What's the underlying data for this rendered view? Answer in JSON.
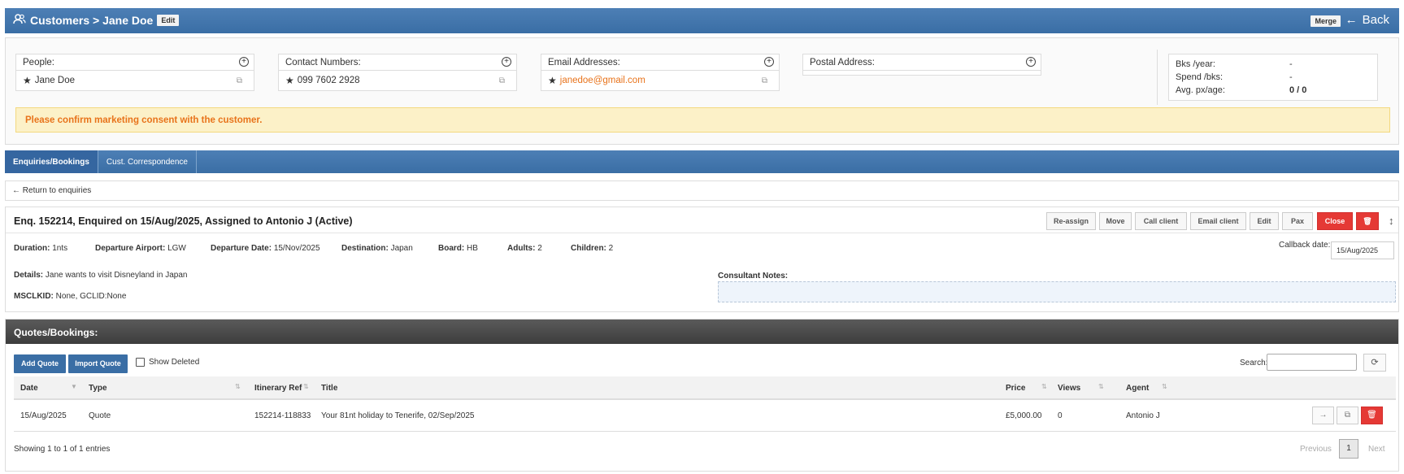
{
  "header": {
    "title": "Customers > Jane Doe",
    "edit_label": "Edit",
    "merge_label": "Merge",
    "back_label": "Back",
    "icon": "users-icon"
  },
  "customer": {
    "people_label": "People:",
    "people_value": "Jane Doe",
    "contact_label": "Contact Numbers:",
    "contact_value": "099 7602 2928",
    "email_label": "Email Addresses:",
    "email_value": "janedoe@gmail.com",
    "postal_label": "Postal Address:",
    "postal_value": "",
    "stats": [
      {
        "label": "Bks /year:",
        "value": "-"
      },
      {
        "label": "Spend /bks:",
        "value": "-"
      },
      {
        "label": "Avg. px/age:",
        "value": "0 / 0"
      }
    ],
    "alert": "Please confirm marketing consent with the customer."
  },
  "tabs": [
    "Enquiries/Bookings",
    "Cust. Correspondence"
  ],
  "return_label": "Return to enquiries",
  "enquiry": {
    "title": "Enq. 152214, Enquired on 15/Aug/2025, Assigned to Antonio J (Active)",
    "actions": [
      "Re-assign",
      "Move",
      "Call client",
      "Email client",
      "Edit",
      "Pax",
      "Close"
    ],
    "duration_label": "Duration:",
    "duration": "1nts",
    "airport_label": "Departure Airport:",
    "airport": "LGW",
    "depdate_label": "Departure Date:",
    "depdate": "15/Nov/2025",
    "dest_label": "Destination:",
    "dest": "Japan",
    "board_label": "Board:",
    "board": "HB",
    "adults_label": "Adults:",
    "adults": "2",
    "children_label": "Children:",
    "children": "2",
    "callback_label": "Callback date:",
    "callback": "15/Aug/2025",
    "details_label": "Details:",
    "details": "Jane wants to visit Disneyland in Japan",
    "msclkid_label": "MSCLKID:",
    "msclkid": "None, GCLID:None",
    "notes_label": "Consultant Notes:"
  },
  "quotes": {
    "title": "Quotes/Bookings:",
    "add_label": "Add Quote",
    "import_label": "Import Quote",
    "show_deleted": "Show Deleted",
    "search_label": "Search:",
    "columns": [
      "Date",
      "Type",
      "Itinerary Ref",
      "Title",
      "Price",
      "Views",
      "Agent"
    ],
    "rows": [
      {
        "date": "15/Aug/2025",
        "type": "Quote",
        "ref": "152214-118833",
        "title": "Your 81nt holiday to Tenerife, 02/Sep/2025",
        "price": "£5,000.00",
        "views": "0",
        "agent": "Antonio J"
      }
    ],
    "showing": "Showing 1 to 1 of 1 entries",
    "prev": "Previous",
    "page": "1",
    "next": "Next"
  }
}
